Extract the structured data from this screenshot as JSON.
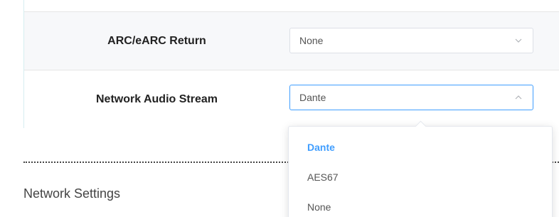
{
  "settings": {
    "arc_row": {
      "label": "ARC/eARC Return",
      "value": "None",
      "icon": "chevron-down-icon"
    },
    "network_audio_row": {
      "label": "Network Audio Stream",
      "value": "Dante",
      "icon": "chevron-up-icon",
      "state": "open"
    }
  },
  "dropdown": {
    "options": [
      "Dante",
      "AES67",
      "None"
    ],
    "selected": "Dante"
  },
  "section": {
    "title": "Network Settings"
  },
  "colors": {
    "accent": "#409eff",
    "row_alt_background": "#f7f8fa",
    "table_border": "#d6eef0"
  }
}
